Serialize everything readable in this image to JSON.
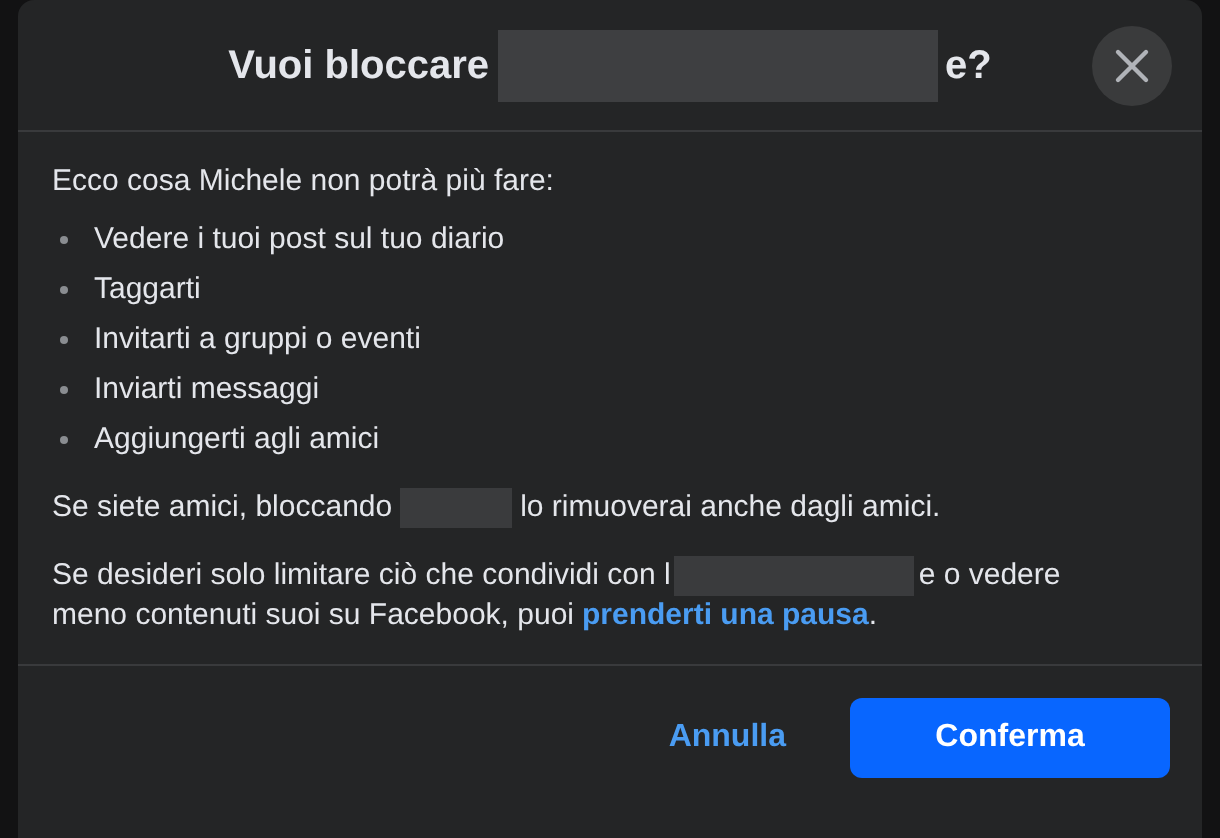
{
  "dialog": {
    "title": [
      {
        "kind": "text",
        "text": "Vuoi bloccare"
      },
      {
        "kind": "redacted"
      },
      {
        "kind": "text",
        "text": "e?"
      }
    ],
    "intro": "Ecco cosa Michele non potrà più fare:",
    "restrictions": [
      "Vedere i tuoi post sul tuo diario",
      "Taggarti",
      "Invitarti a gruppi o eventi",
      "Inviarti messaggi",
      "Aggiungerti agli amici"
    ],
    "paragraphs": [
      [
        {
          "kind": "text",
          "text": "Se siete amici, bloccando"
        },
        {
          "kind": "redacted"
        },
        {
          "kind": "text",
          "text": "lo rimuoverai anche dagli amici."
        }
      ],
      [
        {
          "kind": "text",
          "text": "Se desideri solo limitare ciò che condividi con l"
        },
        {
          "kind": "wideredacted"
        },
        {
          "kind": "text",
          "text": "e o vedere"
        },
        {
          "kind": "text",
          "text": "meno contenuti suoi su Facebook, puoi"
        },
        {
          "kind": "link",
          "text": "prenderti una pausa"
        },
        {
          "kind": "text",
          "text": "."
        }
      ]
    ],
    "buttons": {
      "cancel": "Annulla",
      "confirm": "Conferma"
    }
  }
}
